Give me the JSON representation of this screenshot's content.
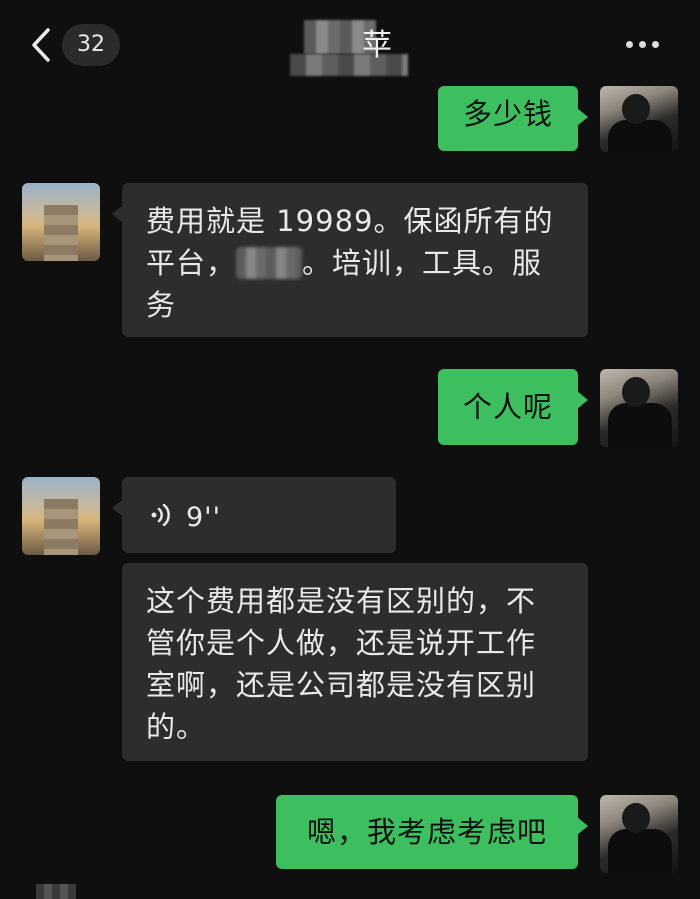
{
  "header": {
    "back_icon": "chevron-left-icon",
    "unread_count": "32",
    "title_visible": "苹",
    "more_icon": "more-dots-icon"
  },
  "messages": [
    {
      "side": "me",
      "type": "text",
      "text": "多少钱"
    },
    {
      "side": "other",
      "type": "text",
      "line1": "费用就是 19989。保函所有的",
      "line2_pre": "平台，",
      "line2_post": "。培训，工具。服",
      "line3": "务"
    },
    {
      "side": "me",
      "type": "text",
      "text": "个人呢"
    },
    {
      "side": "other",
      "type": "voice",
      "duration": "9''",
      "icon": "voice-wave-icon"
    },
    {
      "side": "other",
      "type": "text",
      "line1": "这个费用都是没有区别的，不",
      "line2": "管你是个人做，还是说开工作",
      "line3": "室啊，还是公司都是没有区别",
      "line4": "的。"
    },
    {
      "side": "me",
      "type": "text",
      "text": "嗯，我考虑考虑吧"
    }
  ],
  "colors": {
    "background": "#0f0f0f",
    "my_bubble": "#3dbe5f",
    "their_bubble": "#2d2d2d"
  }
}
